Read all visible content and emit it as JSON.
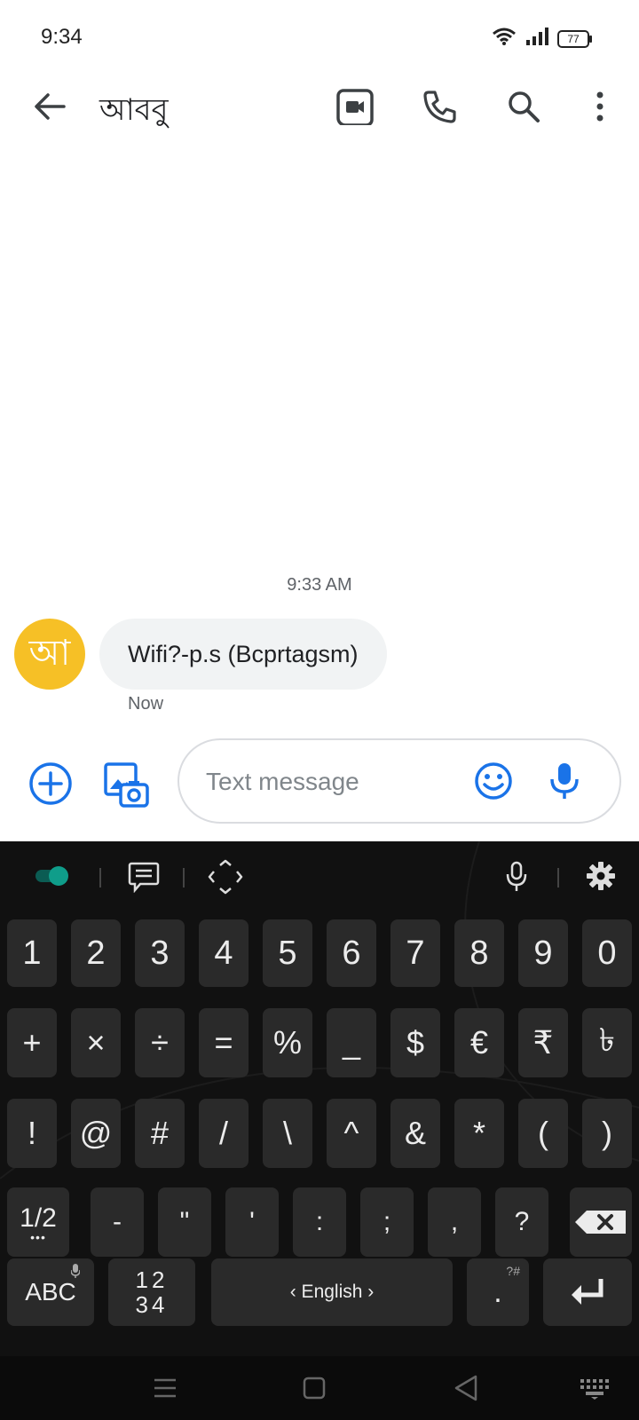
{
  "status_bar": {
    "time": "9:34",
    "battery": "77"
  },
  "header": {
    "title": "আববু"
  },
  "conversation": {
    "timestamp": "9:33 AM",
    "avatar_letter": "আ",
    "messages": [
      {
        "text": "Wifi?-p.s (Bcprtagsm)",
        "status": "Now"
      }
    ]
  },
  "compose": {
    "placeholder": "Text message",
    "value": ""
  },
  "keyboard": {
    "row1": [
      "1",
      "2",
      "3",
      "4",
      "5",
      "6",
      "7",
      "8",
      "9",
      "0"
    ],
    "row2": [
      "+",
      "×",
      "÷",
      "=",
      "%",
      "_",
      "$",
      "€",
      "₹",
      "৳"
    ],
    "row3": [
      "!",
      "@",
      "#",
      "/",
      "\\",
      "^",
      "&",
      "*",
      "(",
      ")"
    ],
    "row4": [
      "-",
      "\"",
      "'",
      ":",
      ";",
      ",",
      "?"
    ],
    "fraction_key": "1/2",
    "abc_key": "ABC",
    "num_key_top": "12",
    "num_key_bottom": "34",
    "space_label": "‹ English ›",
    "period_key": ".",
    "period_hint": "?#"
  },
  "colors": {
    "accent": "#1a73e8",
    "avatar": "#f6c026",
    "toggle": "#0f9d8a"
  }
}
